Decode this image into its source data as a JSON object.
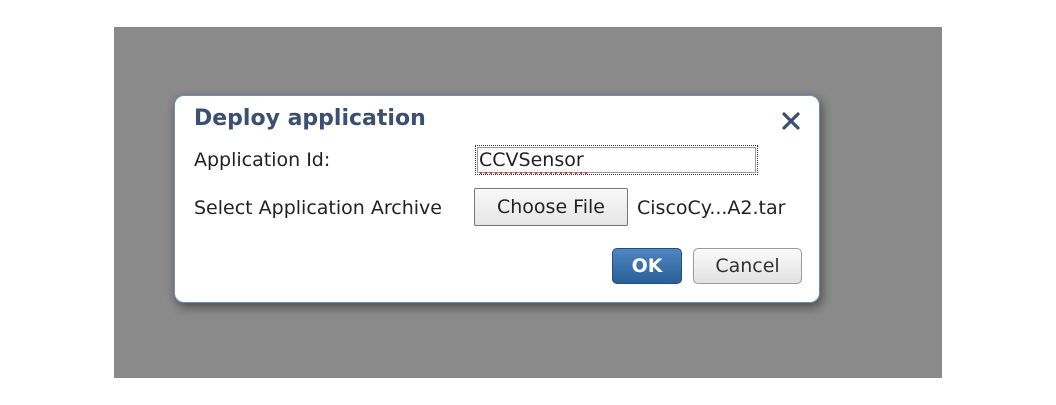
{
  "dialog": {
    "title": "Deploy application",
    "close_icon": "close-icon",
    "fields": {
      "app_id_label": "Application Id:",
      "app_id_value": "CCVSensor",
      "archive_label": "Select Application Archive",
      "choose_file_label": "Choose File",
      "selected_file": "CiscoCy...A2.tar"
    },
    "buttons": {
      "ok_label": "OK",
      "cancel_label": "Cancel"
    }
  },
  "colors": {
    "overlay": "#8a8a8a",
    "title": "#3b4f70",
    "primary_button": "#2a5f98"
  }
}
